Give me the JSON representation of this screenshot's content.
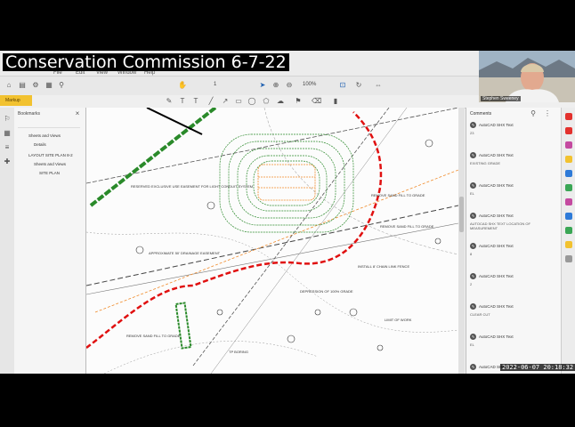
{
  "meeting_title": "Conservation Commission 6-7-22",
  "menubar": {
    "items": [
      "File",
      "Edit",
      "View",
      "Window",
      "Help"
    ]
  },
  "toolbar": {
    "yellow_button": "Markup",
    "page_counter": "1",
    "zoom": "100%"
  },
  "bookmarks": {
    "title": "Bookmarks",
    "items": [
      "Sheets and Views",
      "Details",
      "LAYOUT SITE PLAN 8-2",
      "Sheets and Views",
      "SITE PLAN"
    ]
  },
  "comments": {
    "title": "Comments",
    "entries": [
      {
        "author": "AutoCAD SHX Text",
        "text": "23"
      },
      {
        "author": "AutoCAD SHX Text",
        "text": "EXISTING GRADE"
      },
      {
        "author": "AutoCAD SHX Text",
        "text": "EL"
      },
      {
        "author": "AutoCAD SHX Text",
        "text": "AUTOCAD SHX TEXT LOCATION OF MEASUREMENT"
      },
      {
        "author": "AutoCAD SHX Text",
        "text": "8"
      },
      {
        "author": "AutoCAD SHX Text",
        "text": "2"
      },
      {
        "author": "AutoCAD SHX Text",
        "text": "CLEAR CUT"
      },
      {
        "author": "AutoCAD SHX Text",
        "text": "EL"
      },
      {
        "author": "AutoCAD SHX Text",
        "text": ""
      }
    ]
  },
  "plan_labels": {
    "l1": "RESERVED EXCLUSIVE USE EASEMENT FOR LIGHT CONDUIT SYSTEM",
    "l2": "REMOVE SAND FILL TO GRADE",
    "l3": "APPROXIMATE 50' DRAINAGE EASEMENT",
    "l4": "REMOVE SAND FILL TO GRADE",
    "l5": "INSTALL 8' CHAIN LINK FENCE",
    "l6": "DEPRESSION OF 100% GRADE",
    "l7": "TP BORING",
    "l8": "LIMIT OF WORK",
    "l9": "REMOVE SAND FILL TO GRADE"
  },
  "webcam": {
    "name": "Stephen Sweeney"
  },
  "timestamp": "2022-06-07 20:18:32",
  "colors": {
    "accent": "#f2c230",
    "limit_line": "#e01010",
    "contour": "#2d8a2d"
  }
}
